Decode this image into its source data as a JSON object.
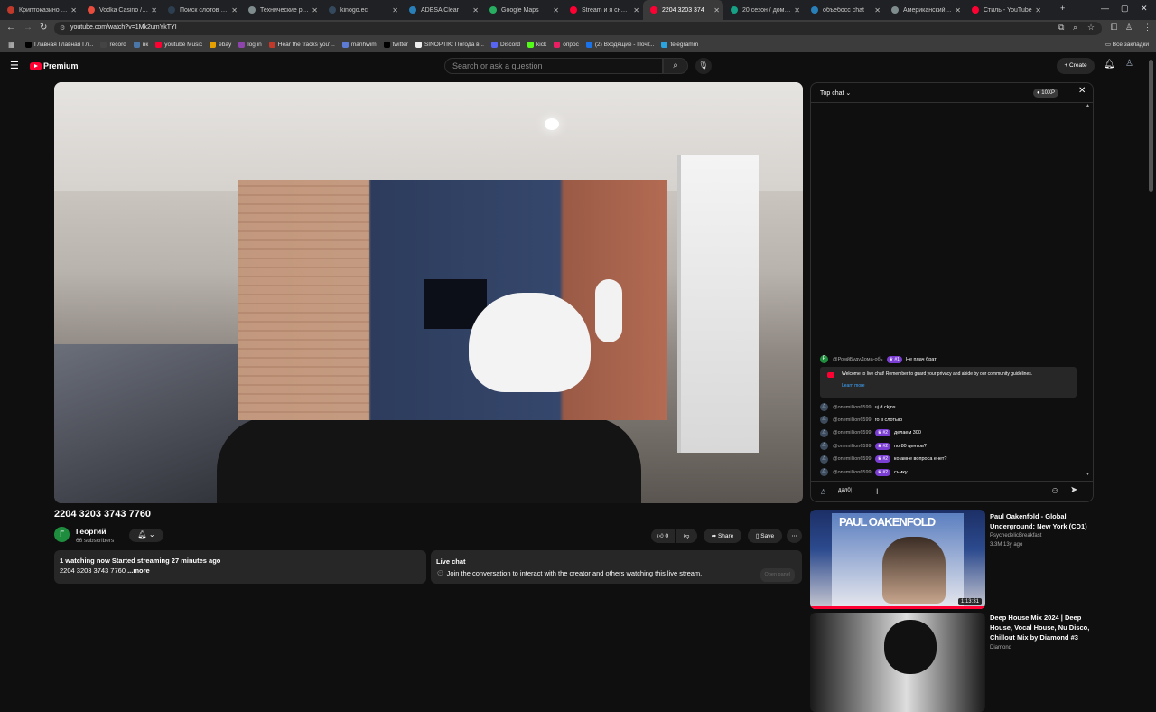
{
  "browser": {
    "tabs": [
      {
        "label": "Криптоказино онл",
        "color": "#c0392b"
      },
      {
        "label": "Vodka Casino / Вод",
        "color": "#e74c3c"
      },
      {
        "label": "Поиск слотов — fr",
        "color": "#2c3e50"
      },
      {
        "label": "Технические работ",
        "color": "#7f8c8d"
      },
      {
        "label": "kinogo.ec",
        "color": "#34495e"
      },
      {
        "label": "ADESA Clear",
        "color": "#2980b9"
      },
      {
        "label": "Google Maps",
        "color": "#27ae60"
      },
      {
        "label": "Stream и я снова за",
        "color": "#ff0033"
      },
      {
        "label": "2204 3203 374",
        "color": "#ff0033"
      },
      {
        "label": "20 сезон / дом.фил",
        "color": "#16a085"
      },
      {
        "label": "объебосс chat",
        "color": "#2980b9"
      },
      {
        "label": "Американский пир",
        "color": "#7f8c8d"
      },
      {
        "label": "Стиль - YouTube",
        "color": "#ff0033"
      }
    ],
    "active_tab_index": 8,
    "url": "youtube.com/watch?v=1Mk2umYkTYI",
    "bookmarks": [
      {
        "label": "Главная Главная Гл...",
        "color": "#000"
      },
      {
        "label": "record",
        "color": "#444"
      },
      {
        "label": "вк",
        "color": "#4a76a8"
      },
      {
        "label": "youtube Music",
        "color": "#ff0033"
      },
      {
        "label": "ebay",
        "color": "#e5a000"
      },
      {
        "label": "log in",
        "color": "#8e44ad"
      },
      {
        "label": "Hear the tracks you'...",
        "color": "#c0392b"
      },
      {
        "label": "manhwim",
        "color": "#5b7bd5"
      },
      {
        "label": "twitter",
        "color": "#000"
      },
      {
        "label": "SINOPTIK: Погода в...",
        "color": "#eee"
      },
      {
        "label": "Discord",
        "color": "#5865f2"
      },
      {
        "label": "kick",
        "color": "#53fc18"
      },
      {
        "label": "опрос",
        "color": "#e91e63"
      },
      {
        "label": "(2) Входящие - Почт...",
        "color": "#1a73e8"
      },
      {
        "label": "telegramm",
        "color": "#2aa3df"
      }
    ],
    "all_bookmarks": "Все закладки"
  },
  "masthead": {
    "logo_text": "Premium",
    "search_placeholder": "Search or ask a question",
    "create_label": "Create"
  },
  "video": {
    "title": "2204 3203 3743 7760",
    "channel_avatar_letter": "Г",
    "channel_name": "Георгий",
    "subscribers": "66 subscribers",
    "like_count": "0",
    "share_label": "Share",
    "save_label": "Save",
    "description_stats": "1 watching now  Started streaming 27 minutes ago",
    "description_text": "2204 3203 3743 7760",
    "more_label": "...more",
    "live_chat_heading": "Live chat",
    "live_chat_text": "Join the conversation to interact with the creator and others watching this live stream.",
    "open_panel_label": "Open panel"
  },
  "chat": {
    "header": "Top chat",
    "xp_label": "10XP",
    "pinned": {
      "author": "@РомйБудуДома-обь",
      "badge": "#1",
      "text": "Не плач брат"
    },
    "welcome_text": "Welcome to live chat! Remember to guard your privacy and abide by our community guidelines.",
    "learn_more": "Learn more",
    "messages": [
      {
        "author": "@onemillion6599",
        "badge": "",
        "text": "uj d ckjns"
      },
      {
        "author": "@onemillion6599",
        "badge": "",
        "text": "го в слотыю"
      },
      {
        "author": "@onemillion6599",
        "badge": "#2",
        "text": "делаем 300"
      },
      {
        "author": "@onemillion6599",
        "badge": "#2",
        "text": "по 80 центов?"
      },
      {
        "author": "@onemillion6599",
        "badge": "#2",
        "text": "ко амне вопроса енет?"
      },
      {
        "author": "@onemillion6599",
        "badge": "#2",
        "text": "сьмку"
      }
    ],
    "input_value": "дал0"
  },
  "recommendations": [
    {
      "title": "Paul Oakenfold - Global Underground: New York (CD1)",
      "channel": "PsychedelicBreakfast",
      "meta": "3.3M  13y ago",
      "duration": "1:13:31",
      "thumb_text": "PAUL OAKENFOLD"
    },
    {
      "title": "Deep House Mix 2024 | Deep House, Vocal House, Nu Disco, Chillout Mix by Diamond #3",
      "channel": "Diamond",
      "meta": "",
      "duration": "",
      "thumb_text": ""
    }
  ]
}
